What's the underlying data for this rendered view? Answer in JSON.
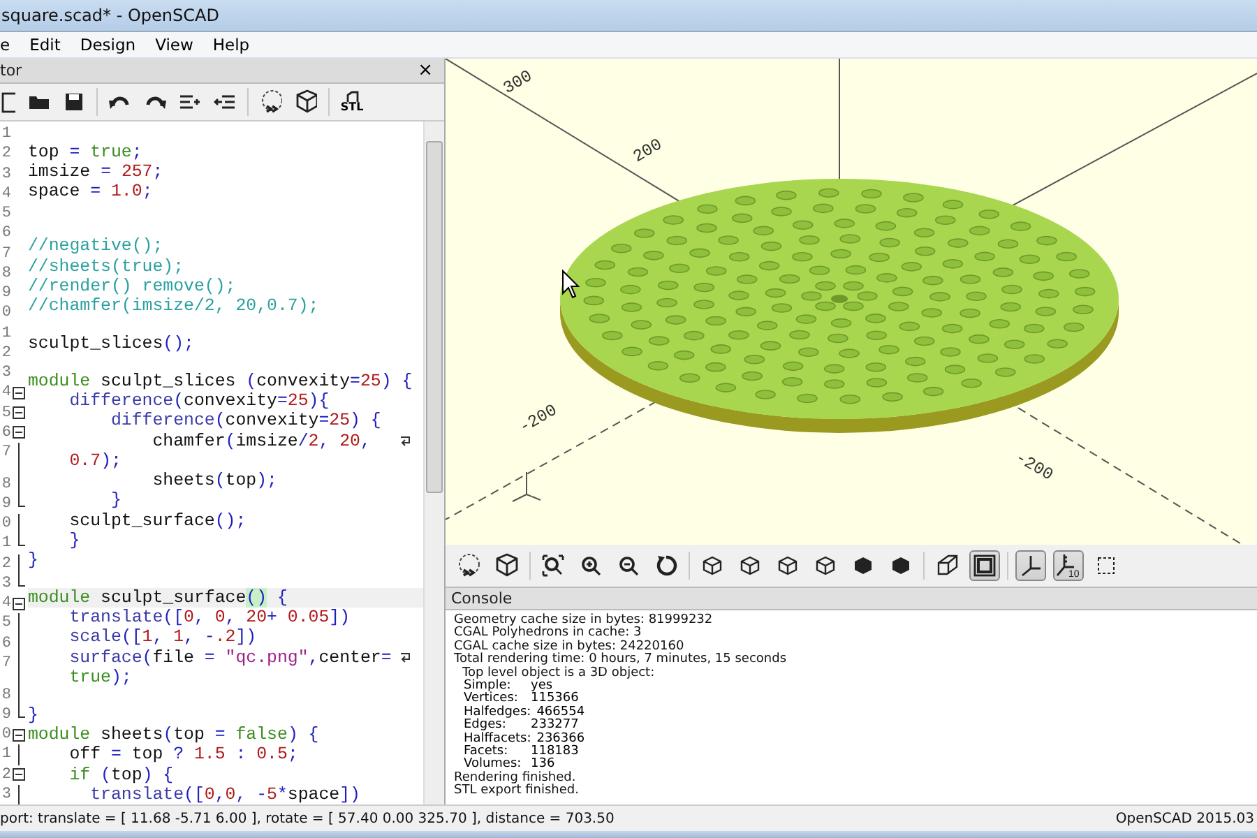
{
  "window": {
    "title": "square.scad* - OpenSCAD"
  },
  "menu": [
    "e",
    "Edit",
    "Design",
    "View",
    "Help"
  ],
  "editor": {
    "title": "tor",
    "close": "×",
    "toolbar": [
      {
        "kind": "new"
      },
      {
        "kind": "open"
      },
      {
        "kind": "save"
      },
      {
        "kind": "sep"
      },
      {
        "kind": "undo"
      },
      {
        "kind": "redo"
      },
      {
        "kind": "indent"
      },
      {
        "kind": "unindent"
      },
      {
        "kind": "sep"
      },
      {
        "kind": "render"
      },
      {
        "kind": "preview"
      },
      {
        "kind": "sep"
      },
      {
        "kind": "stl",
        "label": "STL"
      }
    ],
    "lines": [
      {
        "num": "1"
      },
      {
        "num": "2",
        "tokens": [
          {
            "text": "top ",
            "kind": "plain"
          },
          {
            "text": "= ",
            "kind": "op"
          },
          {
            "text": "true",
            "kind": "keyword"
          },
          {
            "text": ";",
            "kind": "op"
          }
        ]
      },
      {
        "num": "3",
        "tokens": [
          {
            "text": "imsize ",
            "kind": "plain"
          },
          {
            "text": "= ",
            "kind": "op"
          },
          {
            "text": "257",
            "kind": "number"
          },
          {
            "text": ";",
            "kind": "op"
          }
        ]
      },
      {
        "num": "4",
        "tokens": [
          {
            "text": "space ",
            "kind": "plain"
          },
          {
            "text": "= ",
            "kind": "op"
          },
          {
            "text": "1.0",
            "kind": "number"
          },
          {
            "text": ";",
            "kind": "op"
          }
        ]
      },
      {
        "num": "5"
      },
      {
        "num": "6"
      },
      {
        "num": "7",
        "tokens": [
          {
            "text": "//negative();",
            "kind": "comment"
          }
        ]
      },
      {
        "num": "8",
        "tokens": [
          {
            "text": "//sheets(true);",
            "kind": "comment"
          }
        ]
      },
      {
        "num": "9",
        "tokens": [
          {
            "text": "//render() remove();",
            "kind": "comment"
          }
        ]
      },
      {
        "num": "0",
        "tokens": [
          {
            "text": "//chamfer(imsize/2, 20,0.7);",
            "kind": "comment"
          }
        ]
      },
      {
        "num": "1"
      },
      {
        "num": "2",
        "tokens": [
          {
            "text": "sculpt_slices",
            "kind": "plain"
          },
          {
            "text": "();",
            "kind": "op"
          }
        ]
      },
      {
        "num": "3"
      },
      {
        "num": "4",
        "fold_start": true,
        "tokens": [
          {
            "text": "module",
            "kind": "keyword"
          },
          {
            "text": " sculpt_slices ",
            "kind": "plain"
          },
          {
            "text": "(",
            "kind": "op"
          },
          {
            "text": "convexity",
            "kind": "plain"
          },
          {
            "text": "=",
            "kind": "op"
          },
          {
            "text": "25",
            "kind": "number"
          },
          {
            "text": ") {",
            "kind": "op"
          }
        ]
      },
      {
        "num": "5",
        "fold_start": true,
        "tokens": [
          {
            "text": "    difference",
            "kind": "builtin"
          },
          {
            "text": "(",
            "kind": "op"
          },
          {
            "text": "convexity",
            "kind": "plain"
          },
          {
            "text": "=",
            "kind": "op"
          },
          {
            "text": "25",
            "kind": "number"
          },
          {
            "text": "){",
            "kind": "op"
          }
        ]
      },
      {
        "num": "6",
        "fold_start": true,
        "tokens": [
          {
            "text": "        difference",
            "kind": "builtin"
          },
          {
            "text": "(",
            "kind": "op"
          },
          {
            "text": "convexity",
            "kind": "plain"
          },
          {
            "text": "=",
            "kind": "op"
          },
          {
            "text": "25",
            "kind": "number"
          },
          {
            "text": ") {",
            "kind": "op"
          }
        ]
      },
      {
        "num": "7",
        "wrapped": true,
        "tokens": [
          {
            "text": "            chamfer",
            "kind": "plain"
          },
          {
            "text": "(",
            "kind": "op"
          },
          {
            "text": "imsize",
            "kind": "plain"
          },
          {
            "text": "/",
            "kind": "op"
          },
          {
            "text": "2",
            "kind": "number"
          },
          {
            "text": ", ",
            "kind": "op"
          },
          {
            "text": "20",
            "kind": "number"
          },
          {
            "text": ",",
            "kind": "op"
          }
        ]
      },
      {
        "tokens": [
          {
            "text": "    0.7",
            "kind": "number"
          },
          {
            "text": ");",
            "kind": "op"
          }
        ]
      },
      {
        "num": "8",
        "tokens": [
          {
            "text": "            sheets",
            "kind": "plain"
          },
          {
            "text": "(",
            "kind": "op"
          },
          {
            "text": "top",
            "kind": "plain"
          },
          {
            "text": ");",
            "kind": "op"
          }
        ]
      },
      {
        "num": "9",
        "fold_end": true,
        "tokens": [
          {
            "text": "        }",
            "kind": "op"
          }
        ]
      },
      {
        "num": "0",
        "tokens": [
          {
            "text": "    sculpt_surface",
            "kind": "plain"
          },
          {
            "text": "();",
            "kind": "op"
          }
        ]
      },
      {
        "num": "1",
        "fold_end": true,
        "tokens": [
          {
            "text": "    }",
            "kind": "op"
          }
        ]
      },
      {
        "num": "2",
        "tokens": [
          {
            "text": "}",
            "kind": "op"
          }
        ]
      },
      {
        "num": "3",
        "fold_end": true
      },
      {
        "num": "4",
        "fold_start": true,
        "current": true,
        "tokens": [
          {
            "text": "module",
            "kind": "keyword"
          },
          {
            "text": " sculpt_surface",
            "kind": "plain"
          },
          {
            "text": "()",
            "kind": "match"
          },
          {
            "text": " {",
            "kind": "op"
          }
        ]
      },
      {
        "num": "5",
        "tokens": [
          {
            "text": "    translate",
            "kind": "builtin"
          },
          {
            "text": "([",
            "kind": "op"
          },
          {
            "text": "0",
            "kind": "number"
          },
          {
            "text": ", ",
            "kind": "op"
          },
          {
            "text": "0",
            "kind": "number"
          },
          {
            "text": ", ",
            "kind": "op"
          },
          {
            "text": "20",
            "kind": "number"
          },
          {
            "text": "+ ",
            "kind": "op"
          },
          {
            "text": "0.05",
            "kind": "number"
          },
          {
            "text": "])",
            "kind": "op"
          }
        ]
      },
      {
        "num": "6",
        "tokens": [
          {
            "text": "    scale",
            "kind": "builtin"
          },
          {
            "text": "([",
            "kind": "op"
          },
          {
            "text": "1",
            "kind": "number"
          },
          {
            "text": ", ",
            "kind": "op"
          },
          {
            "text": "1",
            "kind": "number"
          },
          {
            "text": ", -",
            "kind": "op"
          },
          {
            "text": ".2",
            "kind": "number"
          },
          {
            "text": "])",
            "kind": "op"
          }
        ]
      },
      {
        "num": "7",
        "wrapped": true,
        "tokens": [
          {
            "text": "    surface",
            "kind": "builtin"
          },
          {
            "text": "(",
            "kind": "op"
          },
          {
            "text": "file ",
            "kind": "plain"
          },
          {
            "text": "= ",
            "kind": "op"
          },
          {
            "text": "\"qc.png\"",
            "kind": "string"
          },
          {
            "text": ",",
            "kind": "op"
          },
          {
            "text": "center",
            "kind": "plain"
          },
          {
            "text": "=",
            "kind": "op"
          }
        ]
      },
      {
        "tokens": [
          {
            "text": "    true",
            "kind": "keyword"
          },
          {
            "text": ");",
            "kind": "op"
          }
        ]
      },
      {
        "num": "8"
      },
      {
        "num": "9",
        "fold_end": true,
        "tokens": [
          {
            "text": "}",
            "kind": "op"
          }
        ]
      },
      {
        "num": "0",
        "fold_start": true,
        "tokens": [
          {
            "text": "module",
            "kind": "keyword"
          },
          {
            "text": " sheets",
            "kind": "plain"
          },
          {
            "text": "(",
            "kind": "op"
          },
          {
            "text": "top ",
            "kind": "plain"
          },
          {
            "text": "= ",
            "kind": "op"
          },
          {
            "text": "false",
            "kind": "keyword"
          },
          {
            "text": ") {",
            "kind": "op"
          }
        ]
      },
      {
        "num": "1",
        "tokens": [
          {
            "text": "    off ",
            "kind": "plain"
          },
          {
            "text": "= ",
            "kind": "op"
          },
          {
            "text": "top ",
            "kind": "plain"
          },
          {
            "text": "? ",
            "kind": "op"
          },
          {
            "text": "1.5",
            "kind": "number"
          },
          {
            "text": " : ",
            "kind": "op"
          },
          {
            "text": "0.5",
            "kind": "number"
          },
          {
            "text": ";",
            "kind": "op"
          }
        ]
      },
      {
        "num": "2",
        "fold_start": true,
        "tokens": [
          {
            "text": "    if",
            "kind": "keyword"
          },
          {
            "text": " (",
            "kind": "op"
          },
          {
            "text": "top",
            "kind": "plain"
          },
          {
            "text": ") {",
            "kind": "op"
          }
        ]
      },
      {
        "num": "3",
        "tokens": [
          {
            "text": "      translate",
            "kind": "builtin"
          },
          {
            "text": "([",
            "kind": "op"
          },
          {
            "text": "0",
            "kind": "number"
          },
          {
            "text": ",",
            "kind": "op"
          },
          {
            "text": "0",
            "kind": "number"
          },
          {
            "text": ", -",
            "kind": "op"
          },
          {
            "text": "5",
            "kind": "number"
          },
          {
            "text": "*",
            "kind": "op"
          },
          {
            "text": "space",
            "kind": "plain"
          },
          {
            "text": "])",
            "kind": "op"
          }
        ]
      }
    ]
  },
  "viewport": {
    "axis_labels": [
      "300",
      "200",
      "-200",
      "-200"
    ],
    "toolbar": [
      {
        "kind": "render",
        "selected": false
      },
      {
        "kind": "export",
        "selected": false
      },
      {
        "kind": "sep"
      },
      {
        "kind": "view-all",
        "selected": false
      },
      {
        "kind": "zoom-in",
        "selected": false
      },
      {
        "kind": "zoom-out",
        "selected": false
      },
      {
        "kind": "reset",
        "selected": false
      },
      {
        "kind": "sep"
      },
      {
        "kind": "cube",
        "selected": false
      },
      {
        "kind": "cube",
        "selected": false
      },
      {
        "kind": "cube",
        "selected": false
      },
      {
        "kind": "cube",
        "selected": false
      },
      {
        "kind": "cube-solid",
        "selected": false
      },
      {
        "kind": "cube-solid",
        "selected": false
      },
      {
        "kind": "sep"
      },
      {
        "kind": "perspective",
        "selected": false
      },
      {
        "kind": "orthogonal",
        "selected": true
      },
      {
        "kind": "sep"
      },
      {
        "kind": "axes",
        "selected": true
      },
      {
        "kind": "scale",
        "selected": true,
        "label": "10"
      },
      {
        "kind": "edges",
        "selected": false
      }
    ]
  },
  "console": {
    "title": "Console",
    "lines": [
      {
        "text": "Geometry cache size in bytes: 81999232"
      },
      {
        "text": "CGAL Polyhedrons in cache: 3"
      },
      {
        "text": "CGAL cache size in bytes: 24220160"
      },
      {
        "text": "Total rendering time: 0 hours, 7 minutes, 15 seconds"
      },
      {
        "text": "Top level object is a 3D object:",
        "children": [
          {
            "label": "Simple:",
            "value": "yes"
          },
          {
            "label": "Vertices:",
            "value": "115366"
          },
          {
            "label": "Halfedges:",
            "value": "466554"
          },
          {
            "label": "Edges:",
            "value": "233277"
          },
          {
            "label": "Halffacets:",
            "value": "236366"
          },
          {
            "label": "Facets:",
            "value": "118183"
          },
          {
            "label": "Volumes:",
            "value": "136"
          }
        ]
      },
      {
        "text": "Rendering finished."
      },
      {
        "text": "STL export finished."
      }
    ]
  },
  "status_bar": {
    "left": "port: translate = [ 11.68 -5.71 6.00 ], rotate = [ 57.40 0.00 325.70 ], distance = 703.50",
    "right": "OpenSCAD 2015.03"
  }
}
